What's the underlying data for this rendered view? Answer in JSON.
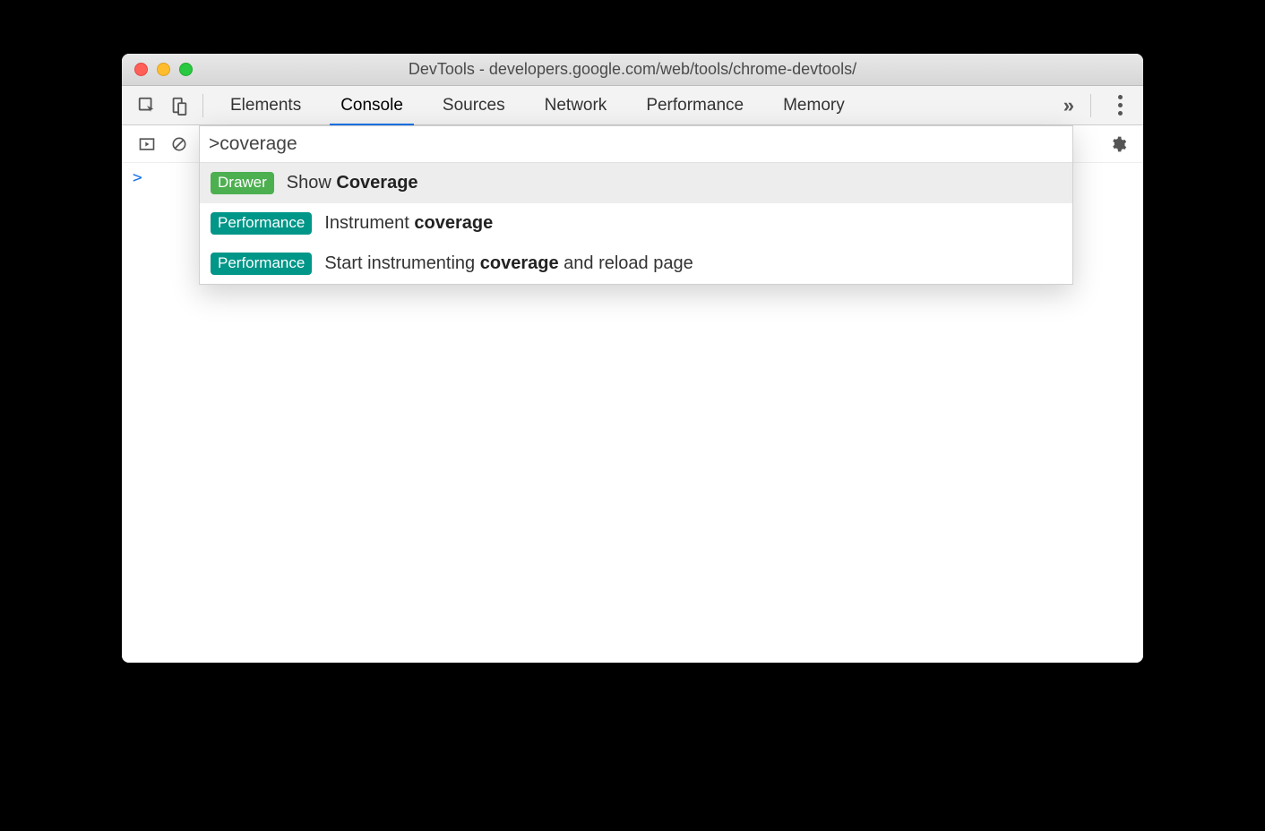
{
  "title": "DevTools - developers.google.com/web/tools/chrome-devtools/",
  "tabs": {
    "elements": "Elements",
    "console": "Console",
    "sources": "Sources",
    "network": "Network",
    "performance": "Performance",
    "memory": "Memory",
    "more": "»"
  },
  "active_tab": "Console",
  "console_prompt": ">",
  "palette": {
    "query": ">coverage",
    "items": [
      {
        "badge": "Drawer",
        "badge_color": "green",
        "text_pre": "Show ",
        "text_bold": "Coverage",
        "text_post": "",
        "selected": true
      },
      {
        "badge": "Performance",
        "badge_color": "teal",
        "text_pre": "Instrument ",
        "text_bold": "coverage",
        "text_post": "",
        "selected": false
      },
      {
        "badge": "Performance",
        "badge_color": "teal",
        "text_pre": "Start instrumenting ",
        "text_bold": "coverage",
        "text_post": " and reload page",
        "selected": false
      }
    ]
  }
}
